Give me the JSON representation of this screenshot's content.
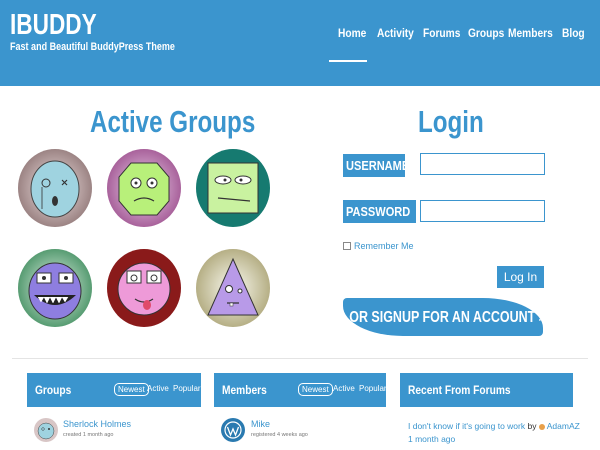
{
  "site": {
    "logo": "IBUDDY",
    "tagline": "Fast and Beautiful BuddyPress Theme"
  },
  "nav": {
    "items": [
      "Home",
      "Activity",
      "Forums",
      "Groups",
      "Members",
      "Blog"
    ],
    "active": "Home"
  },
  "groups_section": {
    "title": "Active Groups"
  },
  "login": {
    "title": "Login",
    "username_label": "USERNAME",
    "password_label": "PASSWORD",
    "remember_label": "Remember Me",
    "login_button": "Log In",
    "signup_label": "OR SIGNUP FOR AN ACCOUNT >>>"
  },
  "widgets": {
    "groups": {
      "title": "Groups",
      "tabs": [
        "Newest",
        "Active",
        "Popular"
      ],
      "item": {
        "name": "Sherlock Holmes",
        "meta": "created 1 month ago"
      }
    },
    "members": {
      "title": "Members",
      "tabs": [
        "Newest",
        "Active",
        "Popular"
      ],
      "item": {
        "name": "Mike",
        "meta": "registered 4 weeks ago"
      }
    },
    "forums": {
      "title": "Recent From Forums",
      "topic": "I don't know if it's going to work",
      "by": "by",
      "author": "AdamAZ",
      "time": "1 month ago"
    }
  },
  "colors": {
    "accent": "#3b95ce",
    "background": "#ffffff"
  }
}
